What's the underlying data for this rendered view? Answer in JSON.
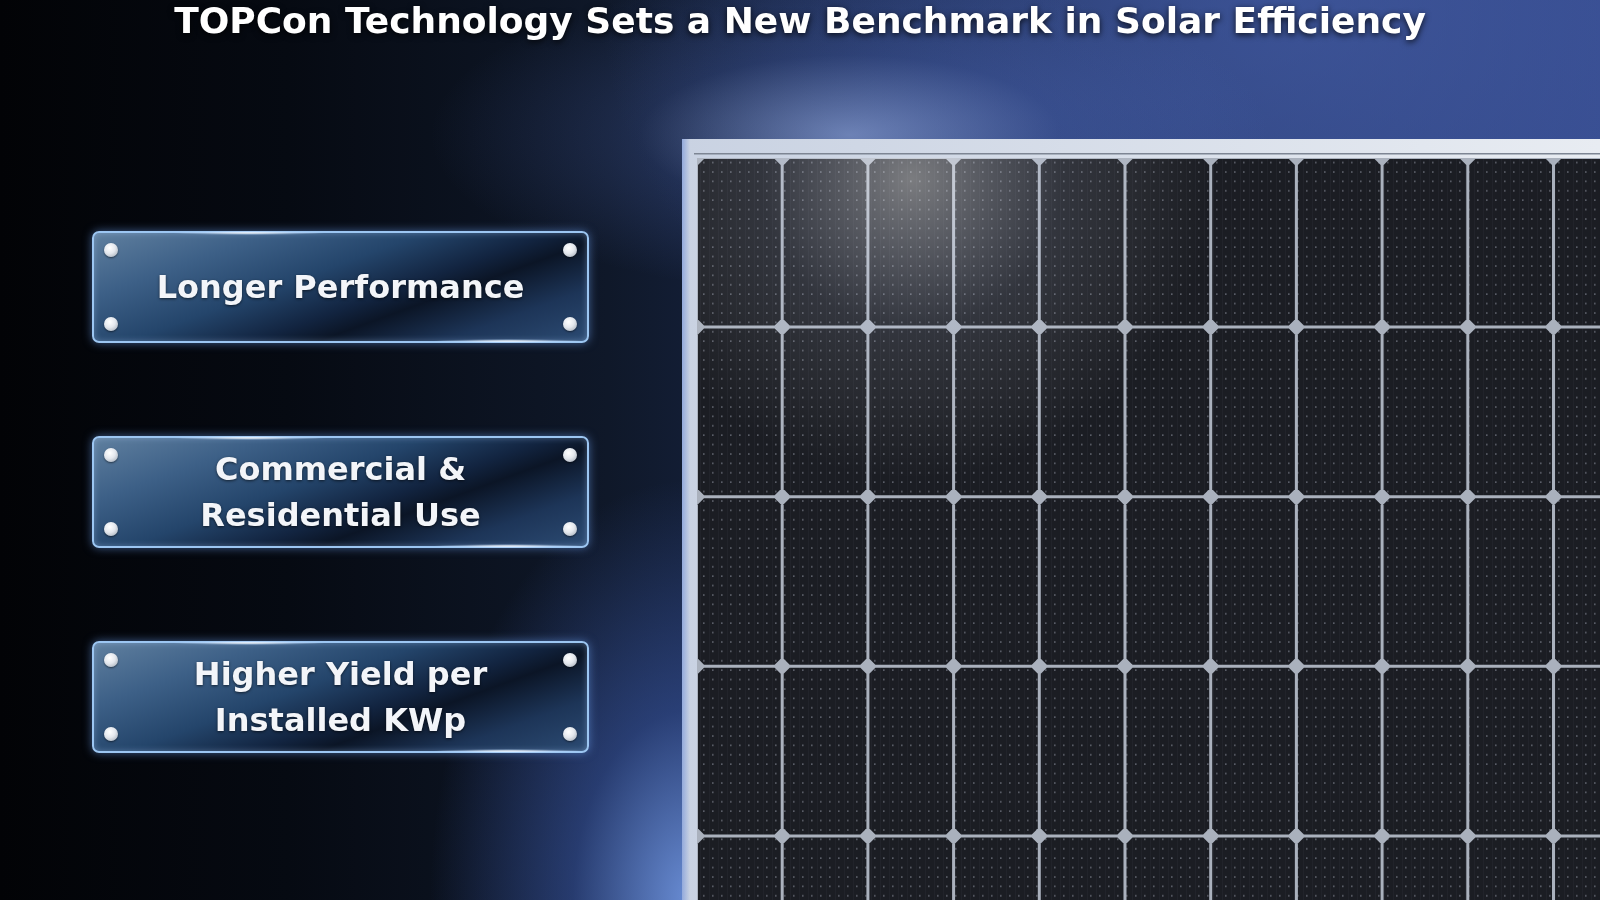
{
  "title": "TOPCon Technology Sets a New Benchmark in Solar Efficiency",
  "features": [
    {
      "label": "Longer Performance"
    },
    {
      "label": "Commercial & Residential Use"
    },
    {
      "label": "Higher Yield per Installed KWp"
    }
  ]
}
